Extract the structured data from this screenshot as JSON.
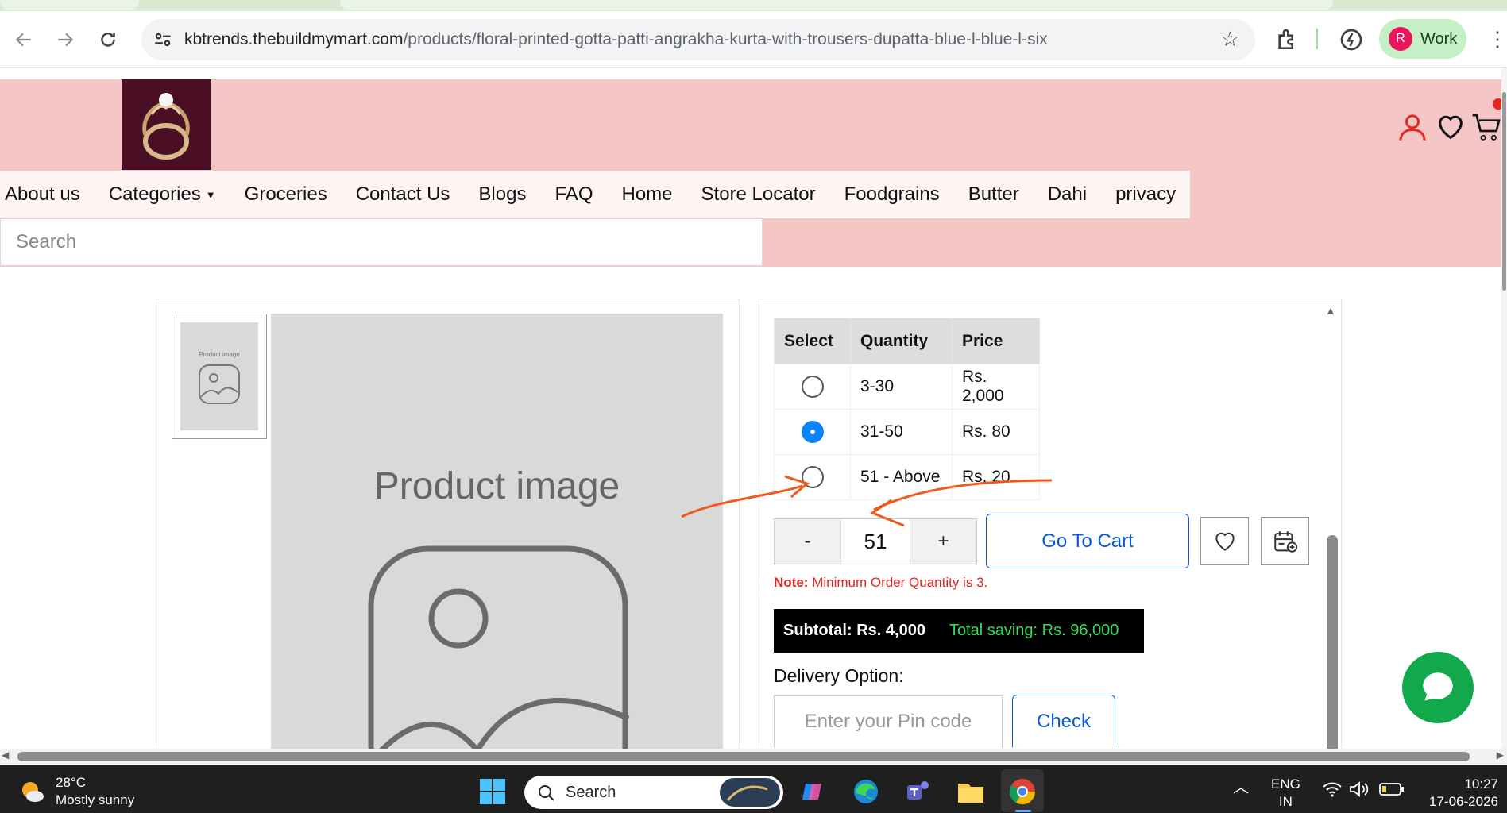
{
  "browser": {
    "url_domain": "kbtrends.thebuildmymart.com",
    "url_path": "/products/floral-printed-gotta-patti-angrakha-kurta-with-trousers-dupatta-blue-l-blue-l-six",
    "profile_initial": "R",
    "profile_label": "Work"
  },
  "header": {
    "menu": [
      "About us",
      "Categories",
      "Groceries",
      "Contact Us",
      "Blogs",
      "FAQ",
      "Home",
      "Store Locator",
      "Foodgrains",
      "Butter",
      "Dahi",
      "privacy"
    ],
    "search_placeholder": "Search"
  },
  "gallery": {
    "thumb_label": "Product image",
    "main_label": "Product image"
  },
  "pricing": {
    "headers": [
      "Select",
      "Quantity",
      "Price"
    ],
    "rows": [
      {
        "quantity": "3-30",
        "price": "Rs. 2,000",
        "selected": false
      },
      {
        "quantity": "31-50",
        "price": "Rs. 80",
        "selected": true
      },
      {
        "quantity": "51 - Above",
        "price": "Rs. 20",
        "selected": false
      }
    ]
  },
  "quantity": {
    "minus": "-",
    "value": "51",
    "plus": "+"
  },
  "buttons": {
    "go_to_cart": "Go To Cart",
    "check": "Check"
  },
  "note": {
    "label": "Note:",
    "text": " Minimum Order Quantity is 3."
  },
  "subtotal": {
    "label": "Subtotal: Rs. 4,000",
    "saving": "Total saving: Rs. 96,000"
  },
  "delivery": {
    "label": "Delivery Option:",
    "pin_placeholder": "Enter your Pin code"
  },
  "taskbar": {
    "temperature": "28°C",
    "weather": "Mostly sunny",
    "search": "Search",
    "lang1": "ENG",
    "lang2": "IN",
    "time": "10:27",
    "date": "17-06-2026"
  },
  "colors": {
    "header_bg": "#f5c6c6",
    "accent_blue": "#0a5ad6",
    "note_red": "#e0241f",
    "saving_green": "#33dd55",
    "annotation": "#f05a1a",
    "chat_green": "#12a84c"
  }
}
